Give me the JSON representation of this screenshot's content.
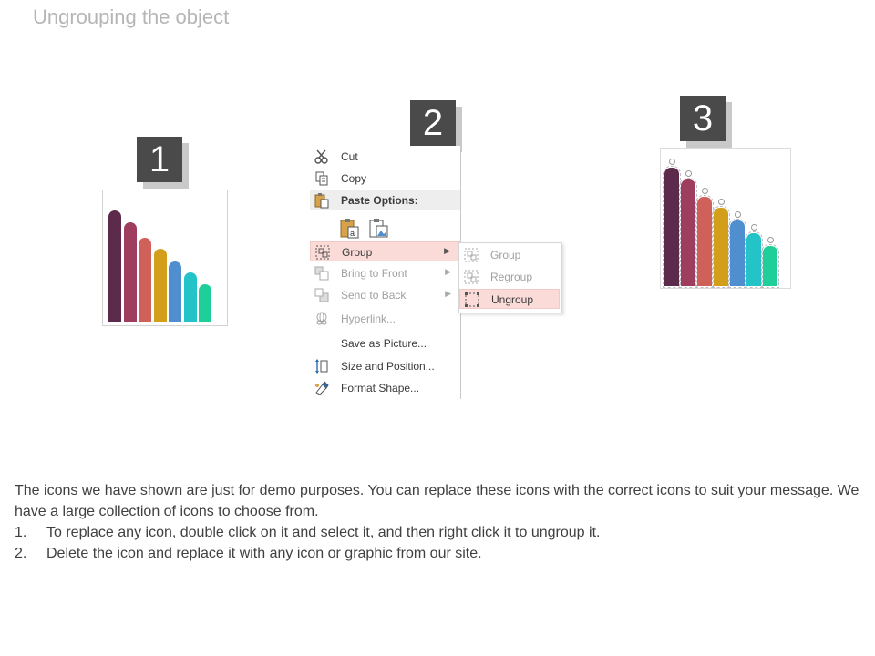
{
  "slide": {
    "title": "Ungrouping the object",
    "steps": [
      "1",
      "2",
      "3"
    ]
  },
  "bar_colors": [
    "#5c2a4a",
    "#9e3d5e",
    "#d0615a",
    "#d39e1a",
    "#4f8fcf",
    "#24c3c8",
    "#1fcf9a"
  ],
  "context_menu": {
    "items": [
      {
        "label": "Cut",
        "icon": "scissors-icon"
      },
      {
        "label": "Copy",
        "icon": "copy-icon"
      },
      {
        "label": "Paste Options:",
        "icon": "paste-icon"
      },
      {
        "label": "Group",
        "icon": "group-icon"
      },
      {
        "label": "Bring to Front",
        "icon": "bring-to-front-icon"
      },
      {
        "label": "Send to Back",
        "icon": "send-to-back-icon"
      },
      {
        "label": "Hyperlink...",
        "icon": "hyperlink-icon"
      },
      {
        "label": "Save as Picture...",
        "icon": "none"
      },
      {
        "label": "Size and Position...",
        "icon": "size-position-icon"
      },
      {
        "label": "Format Shape...",
        "icon": "format-shape-icon"
      }
    ],
    "paste_buttons": [
      "paste-keep-text-icon",
      "paste-picture-icon"
    ]
  },
  "submenu": {
    "items": [
      {
        "label": "Group",
        "icon": "group-icon"
      },
      {
        "label": "Regroup",
        "icon": "regroup-icon"
      },
      {
        "label": "Ungroup",
        "icon": "ungroup-icon"
      }
    ]
  },
  "description": {
    "paragraph": "The icons we have shown are just for demo purposes. You can replace these icons with the correct icons to suit your message. We have a large collection of icons to choose from.",
    "steps": [
      {
        "num": "1.",
        "text": "To replace any icon, double click on it and select it, and then right click it to ungroup it."
      },
      {
        "num": "2.",
        "text": "Delete the icon and replace it with any icon or graphic from our site."
      }
    ]
  }
}
